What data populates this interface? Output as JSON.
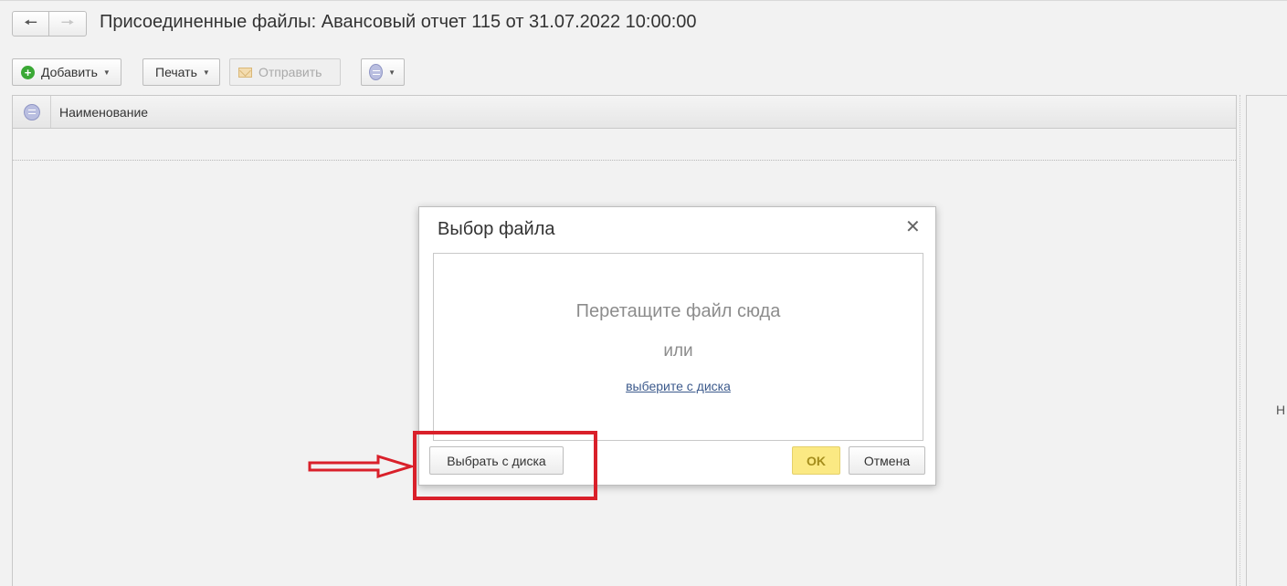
{
  "window": {
    "title": "Присоединенные файлы: Авансовый отчет 115 от 31.07.2022 10:00:00"
  },
  "nav": {
    "back_icon": "arrow-left-icon",
    "forward_icon": "arrow-right-icon"
  },
  "toolbar": {
    "add_label": "Добавить",
    "print_label": "Печать",
    "send_label": "Отправить"
  },
  "table": {
    "columns": [
      "Наименование"
    ],
    "rows": []
  },
  "right_panel": {
    "partial_text": "Н"
  },
  "dialog": {
    "title": "Выбор файла",
    "drop_text": "Перетащите файл сюда",
    "or_text": "или",
    "choose_link": "выберите с диска",
    "choose_button": "Выбрать с диска",
    "ok_button": "OK",
    "cancel_button": "Отмена"
  },
  "annotation": {
    "highlight_color": "#d9202a"
  }
}
